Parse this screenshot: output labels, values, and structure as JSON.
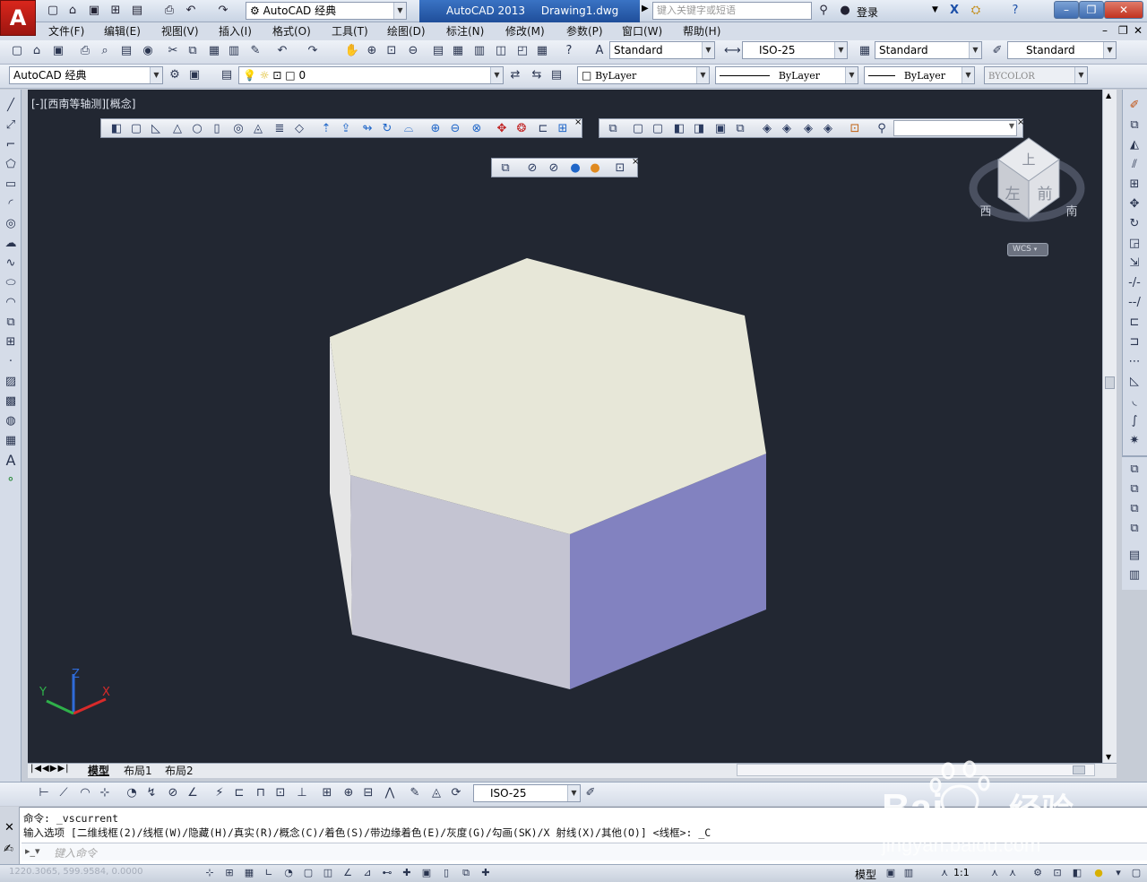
{
  "title_bar": {
    "workspace": "AutoCAD 经典",
    "app_name": "AutoCAD 2013",
    "file_name": "Drawing1.dwg",
    "search_placeholder": "键入关键字或短语",
    "login": "登录"
  },
  "menu": [
    "文件(F)",
    "编辑(E)",
    "视图(V)",
    "插入(I)",
    "格式(O)",
    "工具(T)",
    "绘图(D)",
    "标注(N)",
    "修改(M)",
    "参数(P)",
    "窗口(W)",
    "帮助(H)"
  ],
  "styles_toolbar": {
    "text_style": "Standard",
    "dim_style": "ISO-25",
    "table_style": "Standard",
    "multileader_style": "Standard"
  },
  "layers_toolbar": {
    "workspace": "AutoCAD 经典",
    "layer": "0",
    "color": "ByLayer",
    "linetype": "ByLayer",
    "lineweight": "ByLayer",
    "plot_style": "BYCOLOR"
  },
  "viewport": {
    "label": "[-][西南等轴测][概念]",
    "viewcube": {
      "top": "上",
      "left": "左",
      "front": "前",
      "west": "西",
      "south": "南",
      "wcs": "WCS"
    },
    "ucs": {
      "x": "X",
      "y": "Y",
      "z": "Z"
    },
    "colors": {
      "background": "#222732",
      "top_face": "#e7e7d8",
      "front_face": "#c4c4d2",
      "side_face": "#8282c0",
      "left_face": "#e6e6e6"
    }
  },
  "tabs": [
    "模型",
    "布局1",
    "布局2"
  ],
  "dim_toolbar": {
    "dim_style": "ISO-25"
  },
  "command": {
    "line1": "命令: _vscurrent",
    "line2": "输入选项 [二维线框(2)/线框(W)/隐藏(H)/真实(R)/概念(C)/着色(S)/带边缘着色(E)/灰度(G)/勾画(SK)/X 射线(X)/其他(O)] <线框>: _C",
    "input_placeholder": "键入命令"
  },
  "status": {
    "coordinates": "1220.3065, 599.9584, 0.0000",
    "model": "模型",
    "scale": "1:1"
  },
  "watermark": {
    "brand": "Bai",
    "brand2": "经验",
    "url": "jingyan.baidu.com"
  }
}
